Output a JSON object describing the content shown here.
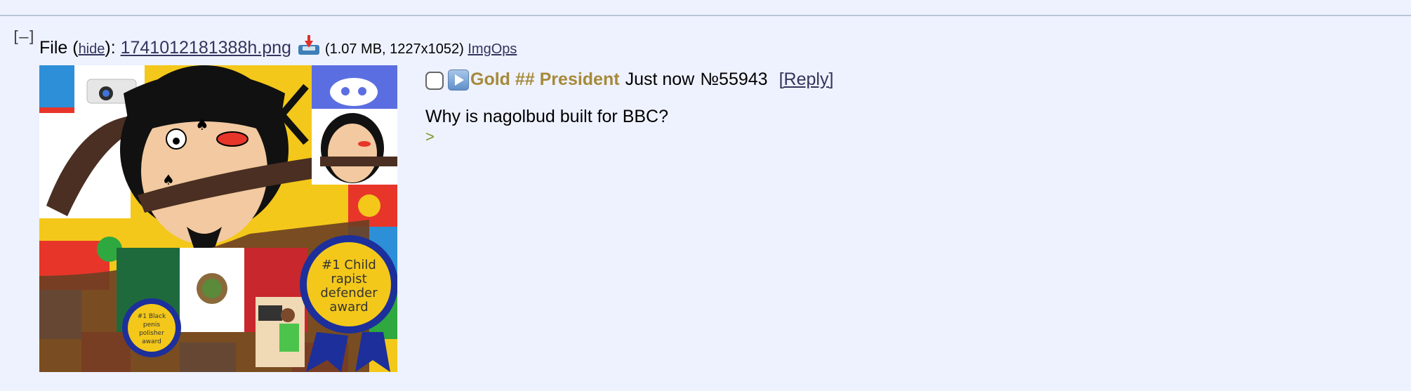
{
  "collapse": "[–]",
  "file": {
    "prefix": "File (",
    "hide_label": "hide",
    "after_hide": "): ",
    "filename": "1741012181388h.png",
    "meta": "(1.07 MB, 1227x1052)",
    "imgops_label": "ImgOps"
  },
  "thumbnail": {
    "ribbon_large_text": [
      "#1 Child",
      "rapist",
      "defender",
      "award"
    ],
    "ribbon_small_text": [
      "#1 Black",
      "penis",
      "polisher",
      "award"
    ]
  },
  "post": {
    "name": "Gold ## President",
    "datetime": "Just now",
    "number": "№55943",
    "reply_label": "[Reply]",
    "message": "Why is nagolbud built for BBC?",
    "quote_line": ">"
  },
  "colors": {
    "background": "#eef2ff",
    "name": "#a68a3a",
    "link": "#34345c",
    "greentext": "#789922",
    "divider": "#b7c5d9"
  }
}
